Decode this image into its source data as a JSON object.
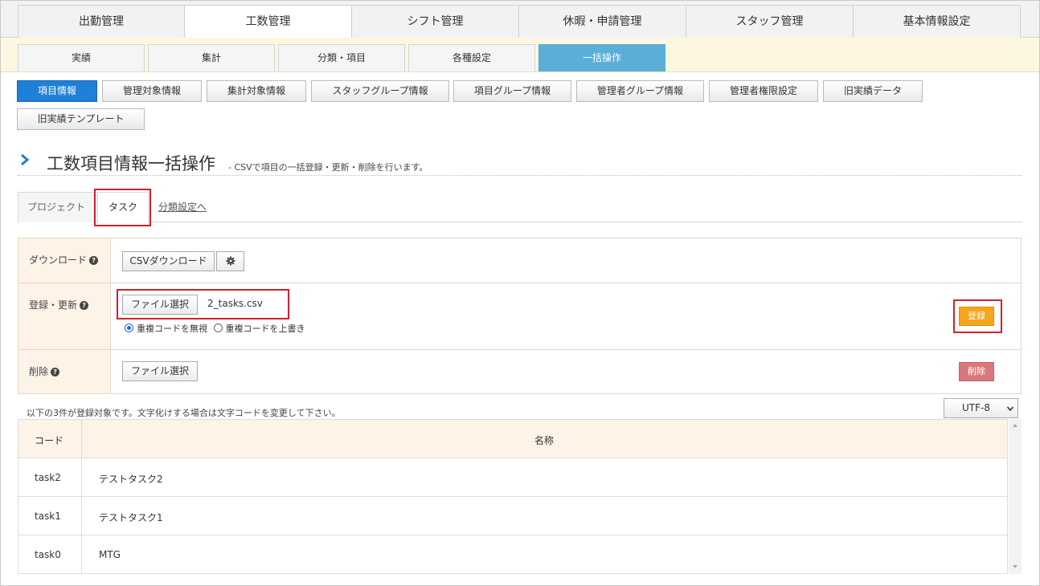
{
  "main_tabs": [
    "出勤管理",
    "工数管理",
    "シフト管理",
    "休暇・申請管理",
    "スタッフ管理",
    "基本情報設定"
  ],
  "sub_tabs": [
    "実績",
    "集計",
    "分類・項目",
    "各種設定",
    "一括操作"
  ],
  "func_buttons": [
    "項目情報",
    "管理対象情報",
    "集計対象情報",
    "スタッフグループ情報",
    "項目グループ情報",
    "管理者グループ情報",
    "管理者権限設定",
    "旧実績データ",
    "旧実績テンプレート"
  ],
  "page": {
    "title": "工数項目情報一括操作",
    "subtitle": "- CSVで項目の一括登録・更新・削除を行います。"
  },
  "kind_tabs": {
    "project": "プロジェクト",
    "task": "タスク",
    "category_link": "分類設定へ"
  },
  "form": {
    "download_label": "ダウンロード",
    "csv_download_button": "CSVダウンロード",
    "register_label": "登録・更新",
    "file_select_button": "ファイル選択",
    "selected_file": "2_tasks.csv",
    "radio_ignore": "重複コードを無視",
    "radio_overwrite": "重複コードを上書き",
    "register_button": "登録",
    "delete_label": "削除",
    "delete_file_button": "ファイル選択",
    "delete_button": "削除"
  },
  "note": "以下の3件が登録対象です。文字化けする場合は文字コードを変更して下さい。",
  "encoding": "UTF-8",
  "table": {
    "headers": [
      "コード",
      "名称"
    ],
    "rows": [
      {
        "code": "task2",
        "name": "テストタスク2"
      },
      {
        "code": "task1",
        "name": "テストタスク1"
      },
      {
        "code": "task0",
        "name": "MTG"
      }
    ]
  },
  "colors": {
    "primary_blue": "#1f7fd9",
    "active_subtab": "#5aaed7",
    "register_orange": "#f7a51c",
    "delete_red": "#d8787a",
    "highlight_red": "#d4202a"
  }
}
